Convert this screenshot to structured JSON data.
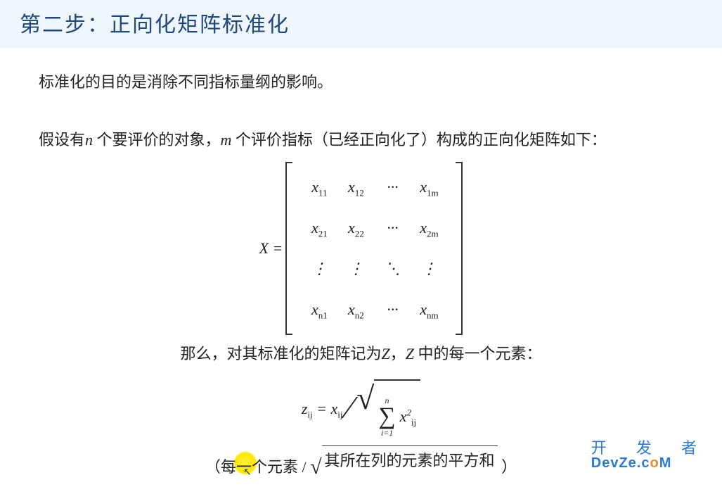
{
  "header": {
    "title": "第二步：正向化矩阵标准化"
  },
  "para1": "标准化的目的是消除不同指标量纲的影响。",
  "para2": {
    "pre": "假设有",
    "nvar": "n",
    "mid1": " 个要评价的对象，",
    "mvar": "m",
    "post": " 个评价指标（已经正向化了）构成的正向化矩阵如下："
  },
  "matrix": {
    "lhs": "X =",
    "rows": [
      [
        "x",
        "11",
        "x",
        "12",
        "···",
        "x",
        "1m"
      ],
      [
        "x",
        "21",
        "x",
        "22",
        "···",
        "x",
        "2m"
      ],
      [
        "⋮",
        "",
        "⋮",
        "",
        "⋱",
        "⋮",
        ""
      ],
      [
        "x",
        "n1",
        "x",
        "n2",
        "···",
        "x",
        "nm"
      ]
    ]
  },
  "para3": {
    "pre": "那么，对其标准化的矩阵记为",
    "zvar": "Z",
    "mid": "，",
    "zvar2": "Z",
    "post": " 中的每一个元素："
  },
  "formula": {
    "lhs_base": "z",
    "lhs_sub": "ij",
    "eq": " = ",
    "num_base": "x",
    "num_sub": "ij",
    "sum_top": "n",
    "sum_bottom": "i=1",
    "term_base": "x",
    "term_sub": "ij",
    "term_sup": "2"
  },
  "desc": {
    "open": "（每",
    "hi": "一个",
    "mid": "元素 / ",
    "root_text": "其所在列的元素的平方和",
    "close": " ）"
  },
  "watermark": {
    "cn": "开 发 者",
    "en_pre": "DevZe.c",
    "en_o": "o",
    "en_post": "M"
  }
}
